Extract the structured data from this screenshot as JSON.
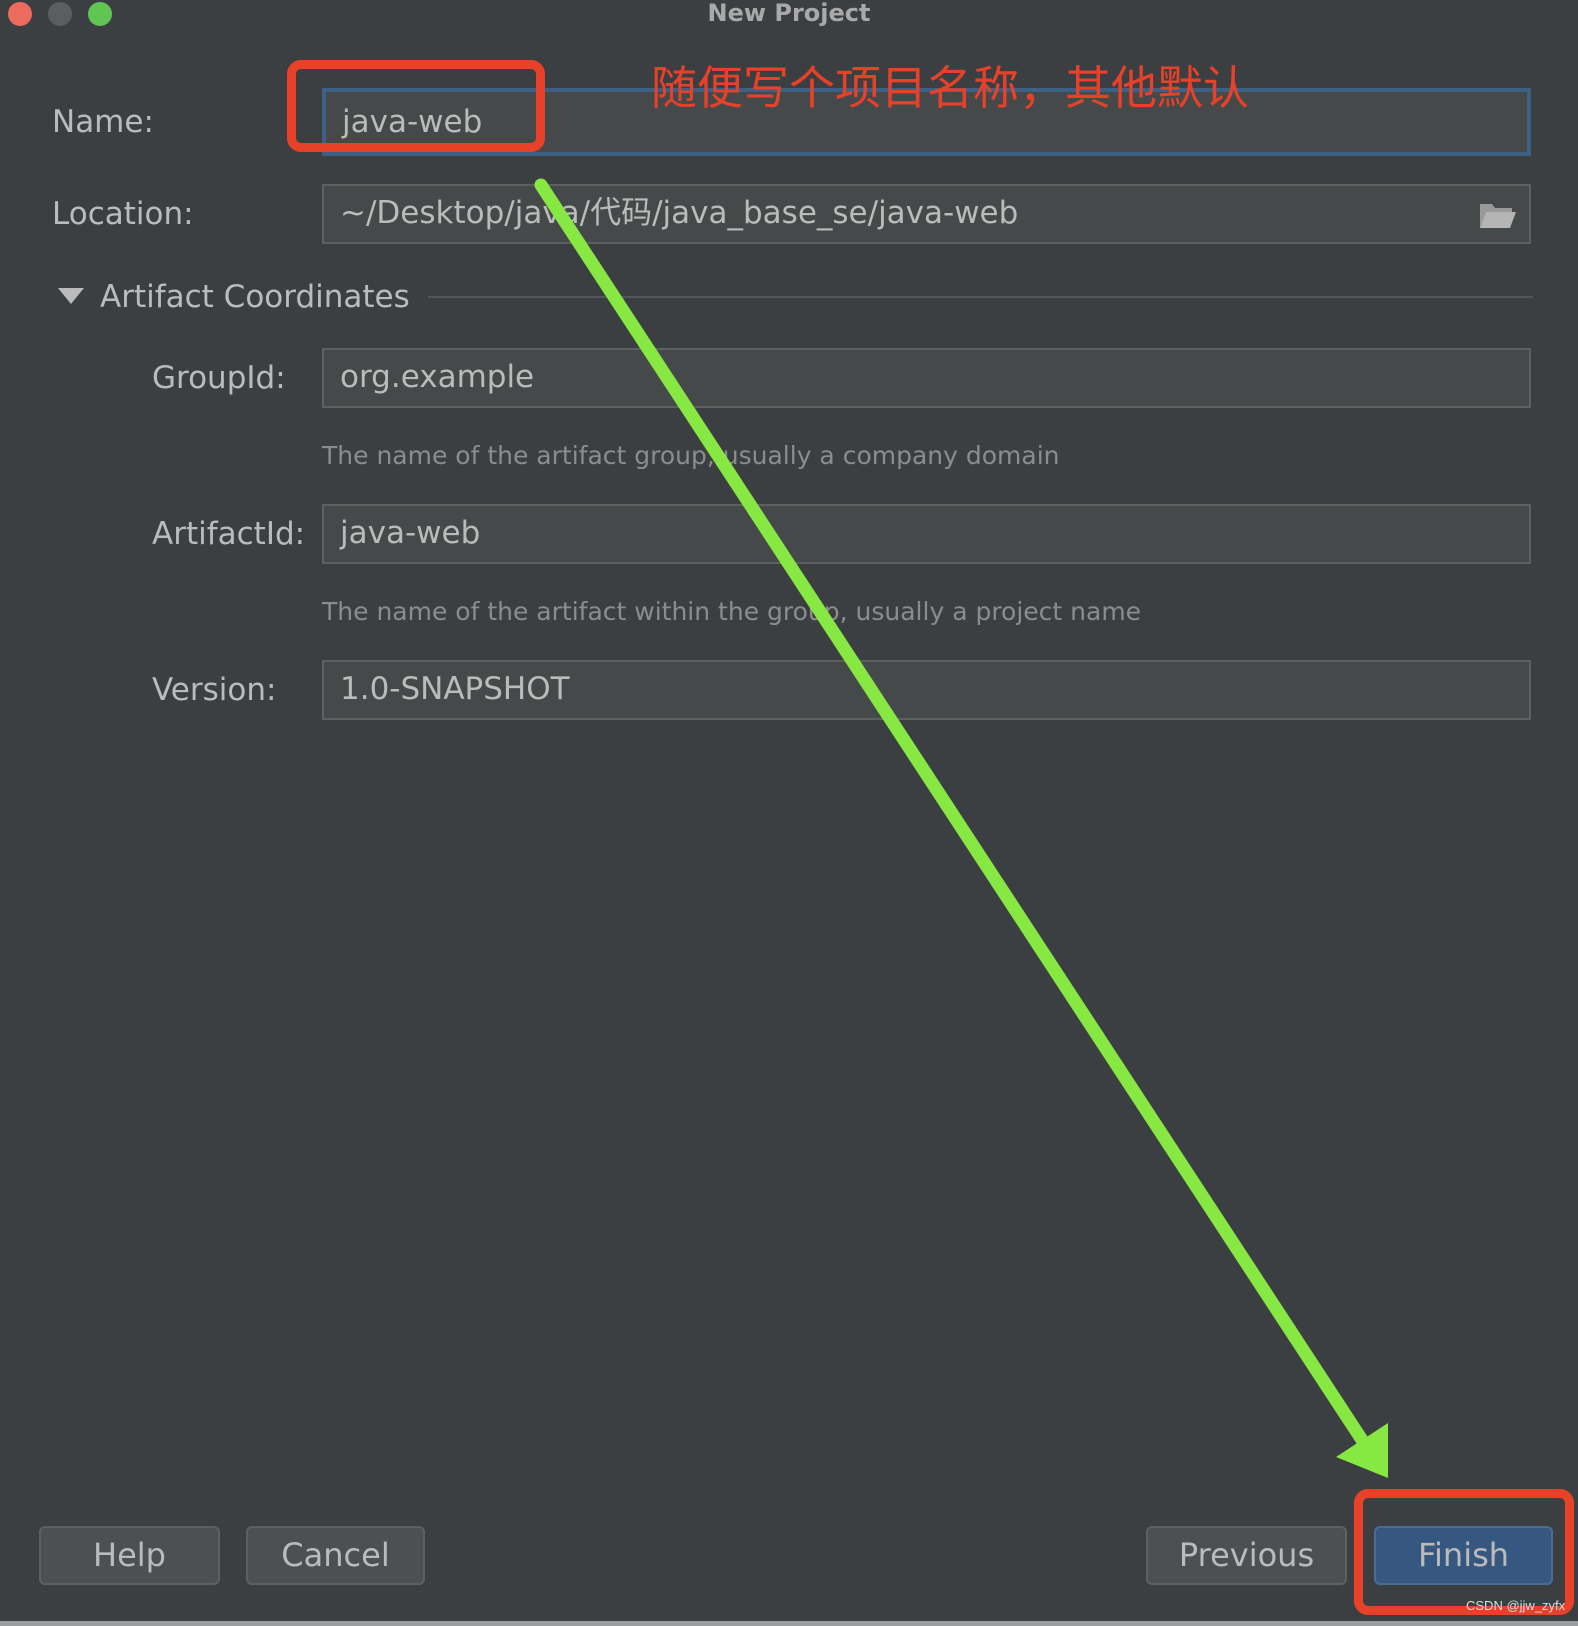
{
  "window": {
    "title": "New Project",
    "traffic_lights": [
      "close",
      "minimize",
      "maximize"
    ]
  },
  "form": {
    "name": {
      "label": "Name:",
      "value": "java-web"
    },
    "location": {
      "label": "Location:",
      "value": "~/Desktop/java/代码/java_base_se/java-web",
      "icon": "folder-icon"
    },
    "section": {
      "label": "Artifact Coordinates",
      "expanded": true
    },
    "group_id": {
      "label": "GroupId:",
      "value": "org.example",
      "hint": "The name of the artifact group, usually a company domain"
    },
    "artifact_id": {
      "label": "ArtifactId:",
      "value": "java-web",
      "hint": "The name of the artifact within the group, usually a project name"
    },
    "version": {
      "label": "Version:",
      "value": "1.0-SNAPSHOT"
    }
  },
  "buttons": {
    "help": "Help",
    "cancel": "Cancel",
    "previous": "Previous",
    "finish": "Finish"
  },
  "annotation": {
    "text": "随便写个项目名称，其他默认",
    "color": "#e8412a",
    "arrow_color": "#88e843"
  },
  "watermark": "CSDN @jjw_zyfx",
  "colors": {
    "accent": "#365880",
    "background": "#3c3f41",
    "field": "#45494a"
  }
}
